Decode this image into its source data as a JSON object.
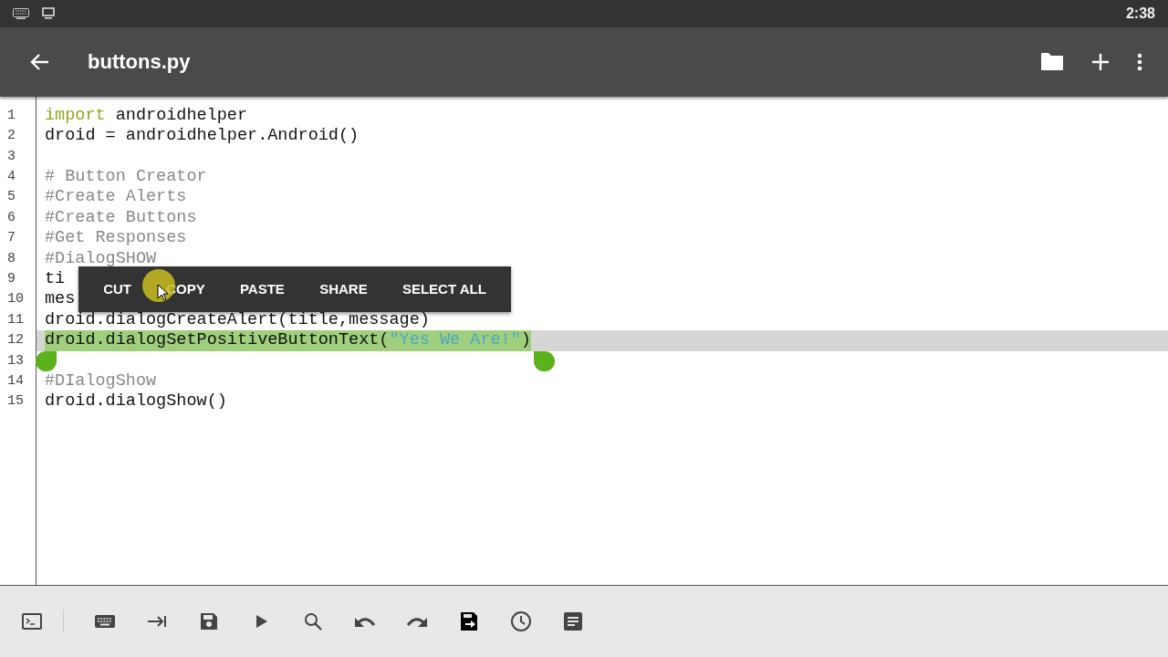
{
  "status_bar": {
    "time": "2:38"
  },
  "app_bar": {
    "title": "buttons.py"
  },
  "editor": {
    "lines": [
      {
        "number": "1",
        "selected": false,
        "tokens": [
          {
            "kind": "keyword",
            "text": "import"
          },
          {
            "kind": "plain",
            "text": " androidhelper"
          }
        ]
      },
      {
        "number": "2",
        "selected": false,
        "tokens": [
          {
            "kind": "plain",
            "text": "droid = androidhelper.Android()"
          }
        ]
      },
      {
        "number": "3",
        "selected": false
      },
      {
        "number": "4",
        "selected": false,
        "tokens": [
          {
            "kind": "comment",
            "text": "# Button Creator"
          }
        ]
      },
      {
        "number": "5",
        "selected": false,
        "tokens": [
          {
            "kind": "comment",
            "text": "#Create Alerts"
          }
        ]
      },
      {
        "number": "6",
        "selected": false,
        "tokens": [
          {
            "kind": "comment",
            "text": "#Create Buttons"
          }
        ]
      },
      {
        "number": "7",
        "selected": false,
        "tokens": [
          {
            "kind": "comment",
            "text": "#Get Responses"
          }
        ]
      },
      {
        "number": "8",
        "selected": false,
        "tokens": [
          {
            "kind": "comment",
            "text": "#DialogSHOW"
          }
        ]
      },
      {
        "number": "9",
        "selected": false,
        "tokens": [
          {
            "kind": "plain",
            "text": "ti"
          }
        ]
      },
      {
        "number": "10",
        "selected": false,
        "tokens": [
          {
            "kind": "plain",
            "text": "mes"
          }
        ]
      },
      {
        "number": "11",
        "selected": false,
        "tokens": [
          {
            "kind": "plain",
            "text": "droid.dialogCreateAlert(title,message)"
          }
        ]
      },
      {
        "number": "12",
        "selected": true,
        "tokens": [
          {
            "kind": "plain",
            "text": "droid.dialogSetPositiveButtonText("
          },
          {
            "kind": "string",
            "text": "\"Yes We Are!\""
          },
          {
            "kind": "plain",
            "text": ")"
          }
        ]
      },
      {
        "number": "13",
        "selected": false
      },
      {
        "number": "14",
        "selected": false,
        "tokens": [
          {
            "kind": "comment",
            "text": "#DIalogShow"
          }
        ]
      },
      {
        "number": "15",
        "selected": false,
        "tokens": [
          {
            "kind": "plain",
            "text": "droid.dialogShow()"
          }
        ]
      }
    ]
  },
  "context_menu": {
    "items": [
      "CUT",
      "COPY",
      "PASTE",
      "SHARE",
      "SELECT ALL"
    ]
  }
}
